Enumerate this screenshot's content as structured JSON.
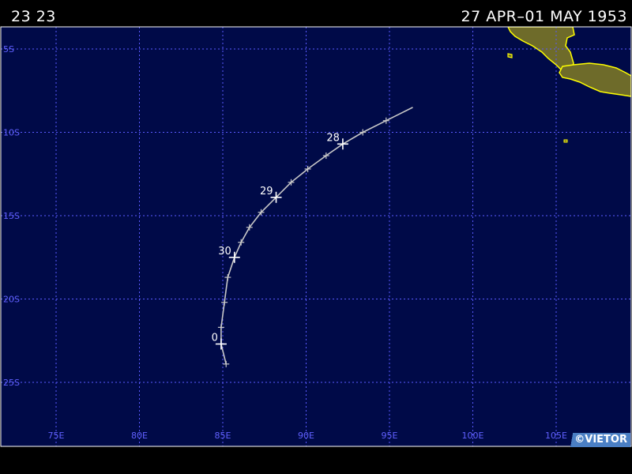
{
  "header": {
    "storm_id": "23 23",
    "date_range": "27 APR–01 MAY 1953"
  },
  "credit": "©VIETOR",
  "colors": {
    "ocean": "#000a48",
    "grid": "#5a5aff",
    "land": "#6e6b2a",
    "coast": "#ffff00",
    "track": "#c8c8c8",
    "axis_label": "#6060ff"
  },
  "map_data": {
    "lon_range": [
      72.0,
      97.5
    ],
    "lat_range": [
      -4.0,
      -29.0
    ],
    "lon_ticks": [
      {
        "value": 75,
        "label": "75E"
      },
      {
        "value": 80,
        "label": "80E"
      },
      {
        "value": 85,
        "label": "85E"
      },
      {
        "value": 90,
        "label": "90E"
      },
      {
        "value": 95,
        "label": "95E"
      },
      {
        "value": 100,
        "label": "100E"
      },
      {
        "value": 105,
        "label": "105E"
      }
    ],
    "lat_ticks": [
      {
        "value": -5,
        "label": "5S"
      },
      {
        "value": -10,
        "label": "10S"
      },
      {
        "value": -15,
        "label": "15S"
      },
      {
        "value": -20,
        "label": "20S"
      },
      {
        "value": -25,
        "label": "25S"
      }
    ],
    "track": [
      [
        96.4,
        -8.5
      ],
      [
        94.8,
        -9.3
      ],
      [
        93.4,
        -10.0
      ],
      [
        92.2,
        -10.7
      ],
      [
        91.2,
        -11.4
      ],
      [
        90.1,
        -12.2
      ],
      [
        89.1,
        -13.0
      ],
      [
        88.2,
        -13.9
      ],
      [
        87.3,
        -14.8
      ],
      [
        86.6,
        -15.7
      ],
      [
        86.1,
        -16.6
      ],
      [
        85.7,
        -17.5
      ],
      [
        85.3,
        -18.7
      ],
      [
        85.1,
        -20.2
      ],
      [
        84.9,
        -21.7
      ],
      [
        84.9,
        -22.7
      ],
      [
        85.2,
        -23.9
      ]
    ],
    "fixes": [
      [
        94.8,
        -9.3
      ],
      [
        93.4,
        -10.0
      ],
      [
        92.2,
        -10.7
      ],
      [
        91.2,
        -11.4
      ],
      [
        90.1,
        -12.2
      ],
      [
        89.1,
        -13.0
      ],
      [
        88.2,
        -13.9
      ],
      [
        87.3,
        -14.8
      ],
      [
        86.6,
        -15.7
      ],
      [
        86.1,
        -16.6
      ],
      [
        85.7,
        -17.5
      ],
      [
        85.3,
        -18.7
      ],
      [
        85.1,
        -20.2
      ],
      [
        84.9,
        -21.7
      ],
      [
        84.9,
        -22.7
      ],
      [
        85.2,
        -23.9
      ]
    ],
    "day_markers": [
      {
        "label": "28",
        "lon": 92.2,
        "lat": -10.7
      },
      {
        "label": "29",
        "lon": 88.2,
        "lat": -13.9
      },
      {
        "label": "30",
        "lon": 85.7,
        "lat": -17.5
      },
      {
        "label": "0",
        "lon": 84.9,
        "lat": -22.7
      }
    ]
  }
}
